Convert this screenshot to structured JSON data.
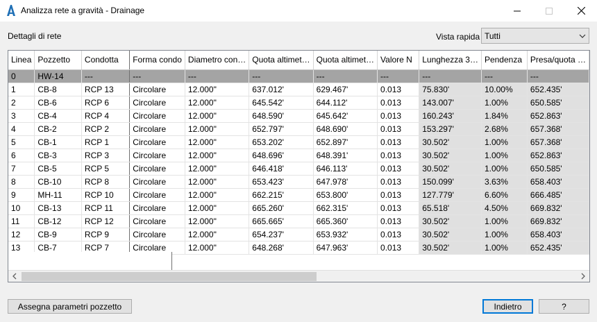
{
  "window": {
    "title": "Analizza rete a gravità - Drainage",
    "icons": {
      "app": "autocad-a-icon",
      "minimize": "minimize-icon",
      "maximize": "maximize-icon",
      "close": "close-icon"
    }
  },
  "section_label": "Dettagli di rete",
  "quick_view": {
    "label": "Vista rapida",
    "selected": "Tutti"
  },
  "grid": {
    "columns": [
      "Linea",
      "Pozzetto",
      "Condotta",
      "Forma condo",
      "Diametro con…",
      "Quota altimet…",
      "Quota altimet…",
      "Valore N",
      "Lunghezza 3…",
      "Pendenza",
      "Presa/quota …"
    ],
    "rows": [
      [
        "0",
        "HW-14",
        "---",
        "---",
        "---",
        "---",
        "---",
        "---",
        "---",
        "---",
        "---"
      ],
      [
        "1",
        "CB-8",
        "RCP 13",
        "Circolare",
        "12.000\"",
        "637.012'",
        "629.467'",
        "0.013",
        "75.830'",
        "10.00%",
        "652.435'"
      ],
      [
        "2",
        "CB-6",
        "RCP 6",
        "Circolare",
        "12.000\"",
        "645.542'",
        "644.112'",
        "0.013",
        "143.007'",
        "1.00%",
        "650.585'"
      ],
      [
        "3",
        "CB-4",
        "RCP 4",
        "Circolare",
        "12.000\"",
        "648.590'",
        "645.642'",
        "0.013",
        "160.243'",
        "1.84%",
        "652.863'"
      ],
      [
        "4",
        "CB-2",
        "RCP 2",
        "Circolare",
        "12.000\"",
        "652.797'",
        "648.690'",
        "0.013",
        "153.297'",
        "2.68%",
        "657.368'"
      ],
      [
        "5",
        "CB-1",
        "RCP 1",
        "Circolare",
        "12.000\"",
        "653.202'",
        "652.897'",
        "0.013",
        "30.502'",
        "1.00%",
        "657.368'"
      ],
      [
        "6",
        "CB-3",
        "RCP 3",
        "Circolare",
        "12.000\"",
        "648.696'",
        "648.391'",
        "0.013",
        "30.502'",
        "1.00%",
        "652.863'"
      ],
      [
        "7",
        "CB-5",
        "RCP 5",
        "Circolare",
        "12.000\"",
        "646.418'",
        "646.113'",
        "0.013",
        "30.502'",
        "1.00%",
        "650.585'"
      ],
      [
        "8",
        "CB-10",
        "RCP 8",
        "Circolare",
        "12.000\"",
        "653.423'",
        "647.978'",
        "0.013",
        "150.099'",
        "3.63%",
        "658.403'"
      ],
      [
        "9",
        "MH-11",
        "RCP 10",
        "Circolare",
        "12.000\"",
        "662.215'",
        "653.800'",
        "0.013",
        "127.779'",
        "6.60%",
        "666.485'"
      ],
      [
        "10",
        "CB-13",
        "RCP 11",
        "Circolare",
        "12.000\"",
        "665.260'",
        "662.315'",
        "0.013",
        "65.518'",
        "4.50%",
        "669.832'"
      ],
      [
        "11",
        "CB-12",
        "RCP 12",
        "Circolare",
        "12.000\"",
        "665.665'",
        "665.360'",
        "0.013",
        "30.502'",
        "1.00%",
        "669.832'"
      ],
      [
        "12",
        "CB-9",
        "RCP 9",
        "Circolare",
        "12.000\"",
        "654.237'",
        "653.932'",
        "0.013",
        "30.502'",
        "1.00%",
        "658.403'"
      ],
      [
        "13",
        "CB-7",
        "RCP 7",
        "Circolare",
        "12.000\"",
        "648.268'",
        "647.963'",
        "0.013",
        "30.502'",
        "1.00%",
        "652.435'"
      ]
    ]
  },
  "buttons": {
    "assegna": "Assegna parametri pozzetto",
    "indietro": "Indietro",
    "help": "?"
  },
  "colors": {
    "accent": "#0078d7",
    "selected_row": "#a4a4a4",
    "readonly_cell": "#e0e0e0"
  }
}
